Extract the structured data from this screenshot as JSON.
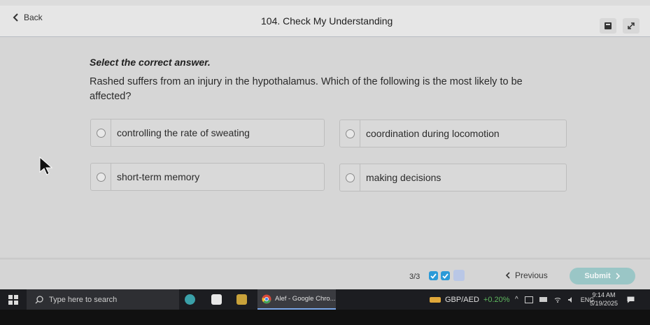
{
  "header": {
    "back_label": "Back",
    "title": "104. Check My Understanding"
  },
  "question": {
    "instruction": "Select the correct answer.",
    "text": "Rashed suffers from an injury in the hypothalamus. Which of the following is the most likely to be affected?",
    "options": [
      {
        "label": "controlling the rate of sweating"
      },
      {
        "label": "coordination during locomotion"
      },
      {
        "label": "short-term memory"
      },
      {
        "label": "making decisions"
      }
    ]
  },
  "footer": {
    "progress_text": "3/3",
    "prev_label": "Previous",
    "submit_label": "Submit",
    "colors": {
      "done": "#2b9ad8",
      "pending": "#b9c7e6",
      "submit_bg": "#9ac6c6"
    }
  },
  "taskbar": {
    "search_placeholder": "Type here to search",
    "active_app_label": "Alef - Google Chro...",
    "ticker_label": "GBP/AED",
    "ticker_change": "+0.20%",
    "language": "ENG",
    "time": "9:14 AM",
    "date": "5/19/2025"
  }
}
